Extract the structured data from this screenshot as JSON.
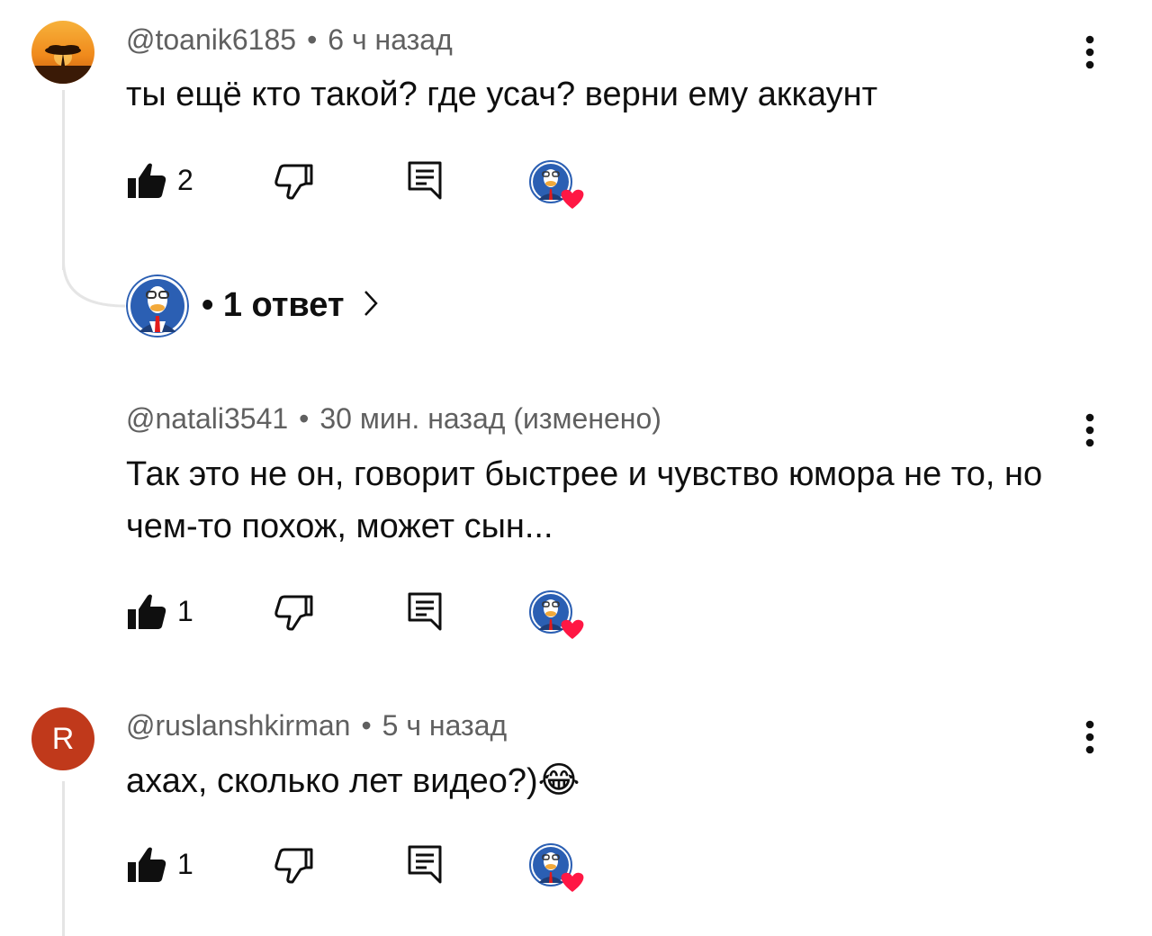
{
  "colors": {
    "meta_text": "#606060",
    "body_text": "#0f0f0f",
    "heart": "#ff1744",
    "avatar_r_bg": "#c0391b",
    "thread_line": "#e5e5e5"
  },
  "comments": [
    {
      "author": "@toanik6185",
      "separator": "•",
      "time": "6 ч назад",
      "text": "ты ещё кто такой? где усач? верни ему аккаунт",
      "likes": "2",
      "avatar_icon": "sunset-tree-avatar"
    },
    {
      "author": "@natali3541",
      "separator": "•",
      "time": "30 мин. назад (изменено)",
      "text": "Так это не он, говорит быстрее и чувство юмора не то, но чем-то похож, может сын...",
      "likes": "1",
      "avatar_icon": "none"
    },
    {
      "author": "@ruslanshkirman",
      "separator": "•",
      "time": "5 ч назад",
      "text": "ахах, сколько лет видео?)",
      "emoji": "😂",
      "likes": "1",
      "avatar_letter": "R"
    }
  ],
  "replies": {
    "label": "• 1 ответ",
    "chevron": "›"
  }
}
